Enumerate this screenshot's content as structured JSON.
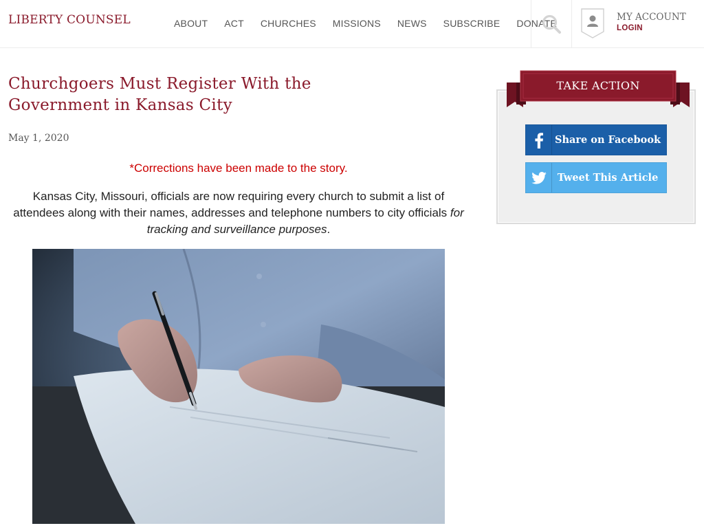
{
  "site": {
    "logo": "LIBERTY COUNSEL"
  },
  "nav": {
    "items": [
      {
        "label": "ABOUT"
      },
      {
        "label": "ACT"
      },
      {
        "label": "CHURCHES"
      },
      {
        "label": "MISSIONS"
      },
      {
        "label": "NEWS"
      },
      {
        "label": "SUBSCRIBE"
      },
      {
        "label": "DONATE"
      }
    ],
    "search_icon": "search-icon"
  },
  "account": {
    "title": "MY ACCOUNT",
    "login": "LOGIN",
    "icon": "user-icon"
  },
  "article": {
    "title": "Churchgoers Must Register With the Government in Kansas City",
    "date": "May 1, 2020",
    "correction": "*Corrections have been made to the story.",
    "lead": "Kansas City, Missouri, officials are now requiring every church to submit a list of attendees along with their names, addresses and telephone numbers to city officials ",
    "lead_emphasis": "for tracking and surveillance purposes",
    "lead_end": "."
  },
  "sidebar": {
    "take_action": "TAKE ACTION",
    "facebook": {
      "label": "Share on Facebook",
      "icon": "facebook-icon",
      "color": "#1b5fa8"
    },
    "twitter": {
      "label": "Tweet This Article",
      "icon": "twitter-icon",
      "color": "#54b0ec"
    }
  },
  "colors": {
    "brand": "#8a1a2b",
    "correction": "#cc0000"
  }
}
